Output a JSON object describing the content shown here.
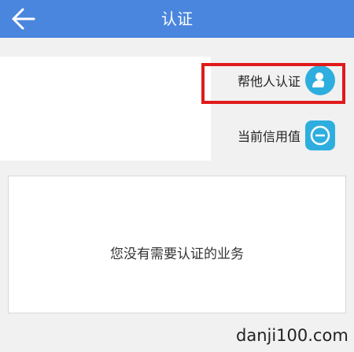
{
  "header": {
    "title": "认证",
    "back_icon": "arrow-left-icon"
  },
  "actions": [
    {
      "label": "帮他人认证",
      "icon": "user-transfer-icon"
    },
    {
      "label": "当前信用值",
      "icon": "credit-gauge-icon"
    }
  ],
  "content": {
    "empty_message": "您没有需要认证的业务"
  },
  "watermark": {
    "text": "danji100.com"
  },
  "colors": {
    "accent": "#4a86dd",
    "icon_bg": "#2eaede",
    "highlight": "#e01b1b"
  }
}
